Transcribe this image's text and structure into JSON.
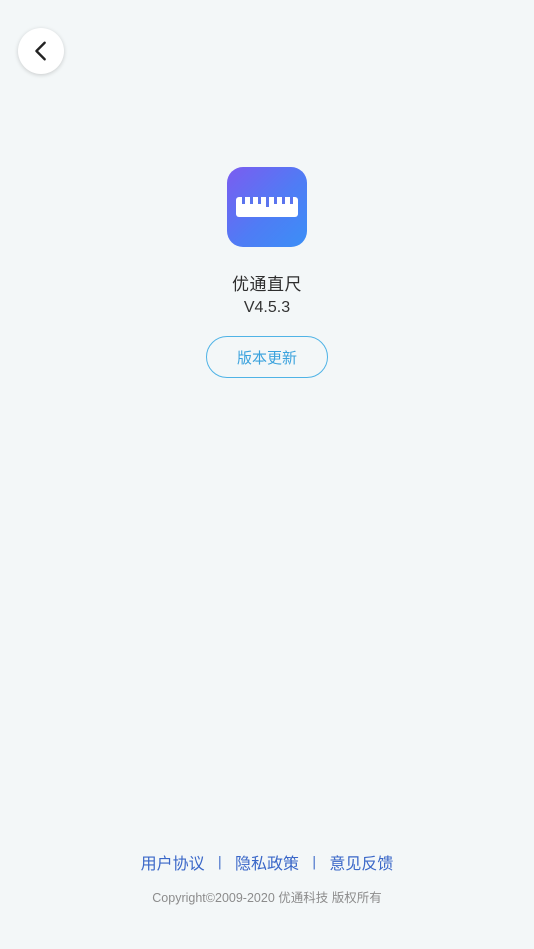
{
  "header": {
    "back_icon": "chevron-left-icon"
  },
  "app": {
    "icon": "ruler-icon",
    "name": "优通直尺",
    "version": "V4.5.3",
    "update_label": "版本更新"
  },
  "footer": {
    "links": [
      "用户协议",
      "隐私政策",
      "意见反馈"
    ],
    "separator": "|",
    "copyright": "Copyright©2009-2020 优通科技 版权所有"
  },
  "colors": {
    "background": "#f3f7f8",
    "link": "#3a67c8",
    "update_button": "#3aa2dd",
    "icon_gradient_start": "#7b5cf0",
    "icon_gradient_end": "#3b8ff6"
  }
}
